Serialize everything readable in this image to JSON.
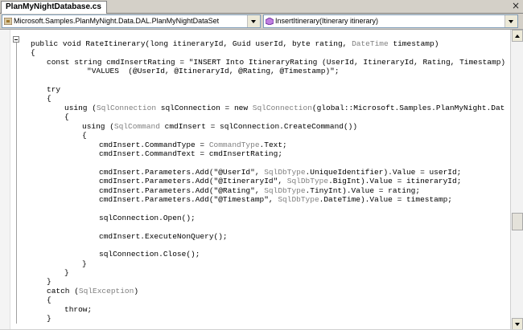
{
  "tab": {
    "title": "PlanMyNightDatabase.cs",
    "close": "×"
  },
  "nav": {
    "type_combo": {
      "text": "Microsoft.Samples.PlanMyNight.Data.DAL.PlanMyNightDataSet",
      "icon": "class-icon"
    },
    "member_combo": {
      "text": "InsertItinerary(Itinerary itinerary)",
      "icon": "method-icon"
    }
  },
  "colors": {
    "keyword": "#000000",
    "type": "#808080",
    "background": "#ffffff"
  },
  "code": {
    "lines": [
      [
        {
          "t": "public void RateItinerary(long itineraryId, Guid userId, byte rating, "
        },
        {
          "t": "DateTime",
          "k": "type"
        },
        {
          "t": " timestamp)"
        }
      ],
      [
        {
          "t": "{"
        }
      ],
      [
        {
          "t": "const string cmdInsertRating = \"INSERT Into ItineraryRating (UserId, ItineraryId, Rating, Timestamp) \" +"
        }
      ],
      [
        {
          "t": "\"VALUES  (@UserId, @ItineraryId, @Rating, @Timestamp)\";"
        }
      ],
      [
        {
          "t": "try"
        }
      ],
      [
        {
          "t": "{"
        }
      ],
      [
        {
          "t": "using ("
        },
        {
          "t": "SqlConnection",
          "k": "type"
        },
        {
          "t": " sqlConnection = new "
        },
        {
          "t": "SqlConnection",
          "k": "type"
        },
        {
          "t": "(global::Microsoft.Samples.PlanMyNight.Data.P"
        }
      ],
      [
        {
          "t": "{"
        }
      ],
      [
        {
          "t": "using ("
        },
        {
          "t": "SqlCommand",
          "k": "type"
        },
        {
          "t": " cmdInsert = sqlConnection.CreateCommand())"
        }
      ],
      [
        {
          "t": "{"
        }
      ],
      [
        {
          "t": "cmdInsert.CommandType = "
        },
        {
          "t": "CommandType",
          "k": "type"
        },
        {
          "t": ".Text;"
        }
      ],
      [
        {
          "t": "cmdInsert.CommandText = cmdInsertRating;"
        }
      ],
      [
        {
          "t": "cmdInsert.Parameters.Add(\"@UserId\", "
        },
        {
          "t": "SqlDbType",
          "k": "type"
        },
        {
          "t": ".UniqueIdentifier).Value = userId;"
        }
      ],
      [
        {
          "t": "cmdInsert.Parameters.Add(\"@ItineraryId\", "
        },
        {
          "t": "SqlDbType",
          "k": "type"
        },
        {
          "t": ".BigInt).Value = itineraryId;"
        }
      ],
      [
        {
          "t": "cmdInsert.Parameters.Add(\"@Rating\", "
        },
        {
          "t": "SqlDbType",
          "k": "type"
        },
        {
          "t": ".TinyInt).Value = rating;"
        }
      ],
      [
        {
          "t": "cmdInsert.Parameters.Add(\"@Timestamp\", "
        },
        {
          "t": "SqlDbType",
          "k": "type"
        },
        {
          "t": ".DateTime).Value = timestamp;"
        }
      ],
      [
        {
          "t": "sqlConnection.Open();"
        }
      ],
      [
        {
          "t": "cmdInsert.ExecuteNonQuery();"
        }
      ],
      [
        {
          "t": "sqlConnection.Close();"
        }
      ],
      [
        {
          "t": "}"
        }
      ],
      [
        {
          "t": "}"
        }
      ],
      [
        {
          "t": "}"
        }
      ],
      [
        {
          "t": "catch ("
        },
        {
          "t": "SqlException",
          "k": "type"
        },
        {
          "t": ")"
        }
      ],
      [
        {
          "t": "{"
        }
      ],
      [
        {
          "t": "throw;"
        }
      ],
      [
        {
          "t": "}"
        }
      ]
    ]
  }
}
